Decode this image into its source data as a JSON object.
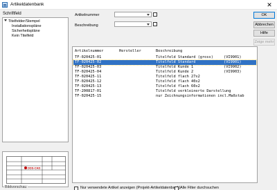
{
  "window": {
    "title": "Artikeldatenbank",
    "close_glyph": "✕"
  },
  "tree_panel": {
    "label": "Schriftfeld",
    "root": "Titelfelder/Stempel",
    "children": [
      "Installationspläne",
      "Sicherheitspläne",
      "Kein Titelfeld"
    ]
  },
  "preview": {
    "label": "Bildvorschau",
    "logo_text": "DDS-CAD"
  },
  "filters": {
    "article_number_label": "Artikelnummer",
    "article_number_value": "",
    "description_label": "Beschreibung",
    "description_value": ""
  },
  "list": {
    "columns": [
      "Artikelnummer",
      "Hersteller",
      "Beschreibung"
    ],
    "rows": [
      {
        "nr": "TF-020425-01",
        "maker": "",
        "desc": "Titelfeld Standard (gross)",
        "code": "(VI9901)",
        "selected": false
      },
      {
        "nr": "TF-020425-02",
        "maker": "",
        "desc": "Titelfeld Standard",
        "code": "(VI9901)",
        "selected": true
      },
      {
        "nr": "TF-020425-03",
        "maker": "",
        "desc": "Titelfeld Kunde 1",
        "code": "(VI9902)",
        "selected": false
      },
      {
        "nr": "TF-020425-04",
        "maker": "",
        "desc": "Titelfeld Kunde 2",
        "code": "(VI9903)",
        "selected": false
      },
      {
        "nr": "TF-020425-11",
        "maker": "",
        "desc": "Titelfeld flach 27x2",
        "code": "",
        "selected": false
      },
      {
        "nr": "TF-020425-12",
        "maker": "",
        "desc": "Titelfeld flach 40x2",
        "code": "",
        "selected": false
      },
      {
        "nr": "TF-020425-13",
        "maker": "",
        "desc": "Titelfeld flach 60x2",
        "code": "",
        "selected": false
      },
      {
        "nr": "TF-200817-01",
        "maker": "",
        "desc": "Titelfeld verkleinerte Darstellung",
        "code": "",
        "selected": false
      },
      {
        "nr": "TF-020425-15",
        "maker": "",
        "desc": "nur Zeichnungsinformationen incl.Maßstab",
        "code": "",
        "selected": false
      }
    ]
  },
  "buttons": {
    "ok": "OK",
    "cancel": "Abbrechen",
    "help": "Hilfe",
    "show_more": "Zeige mehr"
  },
  "bottom": {
    "only_used_label": "Nur verwendete Artikel anzeigen (Projekt-Artikeldatenbank)",
    "all_filters_label": "Alle Filter durchsuchen"
  },
  "colors": {
    "selection": "#3072c5",
    "dialog_bg": "#f0f0f0"
  }
}
